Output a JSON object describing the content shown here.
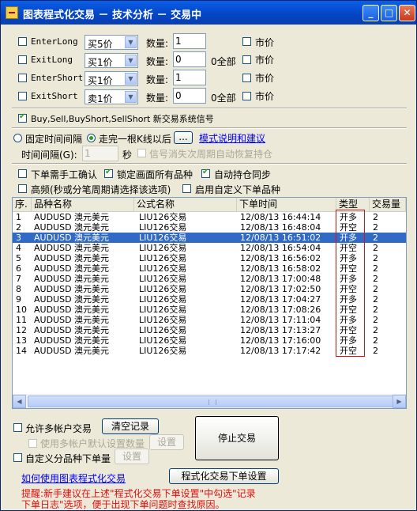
{
  "window": {
    "title": "图表程式化交易 － 技术分析 － 交易中",
    "btn_min": "_",
    "btn_max": "□",
    "btn_close": "✕"
  },
  "orders": [
    {
      "label": "EnterLong",
      "select": "买5价",
      "qty_label": "数量:",
      "qty": "1",
      "all_label": "",
      "market_label": "市价"
    },
    {
      "label": "ExitLong",
      "select": "买1价",
      "qty_label": "数量:",
      "qty": "0",
      "all_label": "0全部",
      "market_label": "市价"
    },
    {
      "label": "EnterShort",
      "select": "买1价",
      "qty_label": "数量:",
      "qty": "1",
      "all_label": "",
      "market_label": "市价"
    },
    {
      "label": "ExitShort",
      "select": "卖1价",
      "qty_label": "数量:",
      "qty": "0",
      "all_label": "0全部",
      "market_label": "市价"
    }
  ],
  "signal_option": {
    "label": "Buy,Sell,BuyShort,SellShort 新交易系统信号",
    "checked": true
  },
  "mode": {
    "fixed_interval_label": "固定时间间隔",
    "bar_close_label": "走完一根K线以后",
    "ellipsis_label": "...",
    "mode_link": "模式说明和建议",
    "interval_label": "时间间隔(G):",
    "interval_value": "1",
    "seconds_label": "秒",
    "auto_recover_label": "信号消失次周期自动恢复持仓"
  },
  "options": {
    "manual_confirm": "下单需手工确认",
    "lock_all": "锁定画面所有品种",
    "auto_sync": "自动持仓同步",
    "high_freq": "高频(秒或分笔周期请选择该选项)",
    "custom_variety": "启用自定义下单品种"
  },
  "table": {
    "columns": [
      "序.",
      "品种名称",
      "公式名称",
      "下单时间",
      "类型",
      "交易量"
    ],
    "rows": [
      {
        "no": "1",
        "variety": "AUDUSD 澳元美元",
        "formula": "LIU126交易",
        "time": "12/08/13 16:44:14",
        "type": "开多",
        "qty": "2"
      },
      {
        "no": "2",
        "variety": "AUDUSD 澳元美元",
        "formula": "LIU126交易",
        "time": "12/08/13 16:48:04",
        "type": "开空",
        "qty": "2"
      },
      {
        "no": "3",
        "variety": "AUDUSD 澳元美元",
        "formula": "LIU126交易",
        "time": "12/08/13 16:51:02",
        "type": "开多",
        "qty": "2"
      },
      {
        "no": "4",
        "variety": "AUDUSD 澳元美元",
        "formula": "LIU126交易",
        "time": "12/08/13 16:54:04",
        "type": "开空",
        "qty": "2"
      },
      {
        "no": "5",
        "variety": "AUDUSD 澳元美元",
        "formula": "LIU126交易",
        "time": "12/08/13 16:56:02",
        "type": "开多",
        "qty": "2"
      },
      {
        "no": "6",
        "variety": "AUDUSD 澳元美元",
        "formula": "LIU126交易",
        "time": "12/08/13 16:58:02",
        "type": "开空",
        "qty": "2"
      },
      {
        "no": "7",
        "variety": "AUDUSD 澳元美元",
        "formula": "LIU126交易",
        "time": "12/08/13 17:00:48",
        "type": "开多",
        "qty": "2"
      },
      {
        "no": "8",
        "variety": "AUDUSD 澳元美元",
        "formula": "LIU126交易",
        "time": "12/08/13 17:02:50",
        "type": "开空",
        "qty": "2"
      },
      {
        "no": "9",
        "variety": "AUDUSD 澳元美元",
        "formula": "LIU126交易",
        "time": "12/08/13 17:04:27",
        "type": "开多",
        "qty": "2"
      },
      {
        "no": "10",
        "variety": "AUDUSD 澳元美元",
        "formula": "LIU126交易",
        "time": "12/08/13 17:08:26",
        "type": "开空",
        "qty": "2"
      },
      {
        "no": "11",
        "variety": "AUDUSD 澳元美元",
        "formula": "LIU126交易",
        "time": "12/08/13 17:11:04",
        "type": "开多",
        "qty": "2"
      },
      {
        "no": "12",
        "variety": "AUDUSD 澳元美元",
        "formula": "LIU126交易",
        "time": "12/08/13 17:13:27",
        "type": "开空",
        "qty": "2"
      },
      {
        "no": "13",
        "variety": "AUDUSD 澳元美元",
        "formula": "LIU126交易",
        "time": "12/08/13 17:16:00",
        "type": "开多",
        "qty": "2"
      },
      {
        "no": "14",
        "variety": "AUDUSD 澳元美元",
        "formula": "LIU126交易",
        "time": "12/08/13 17:17:42",
        "type": "开空",
        "qty": "2"
      }
    ],
    "selected_row": 3
  },
  "bottom": {
    "allow_multi": "允许多帐户交易",
    "clear_records": "清空记录",
    "use_default_qty": "使用多帐户默认设置数量",
    "settings1": "设置",
    "custom_variety_order": "自定义分品种下单量",
    "settings2": "设置",
    "stop_trading": "停止交易",
    "howto_link": "如何使用图表程式化交易",
    "order_settings": "程式化交易下单设置",
    "tip_line1": "提醒:新手建议在上述\"程式化交易下单设置\"中勾选\"记录",
    "tip_line2": "下单日志\"选项，便于出现下单问题时查找原因。"
  },
  "colors": {
    "title_bar": "#0444c4",
    "selection": "#316ac5",
    "tip": "#e01010",
    "link": "#0000ff"
  }
}
